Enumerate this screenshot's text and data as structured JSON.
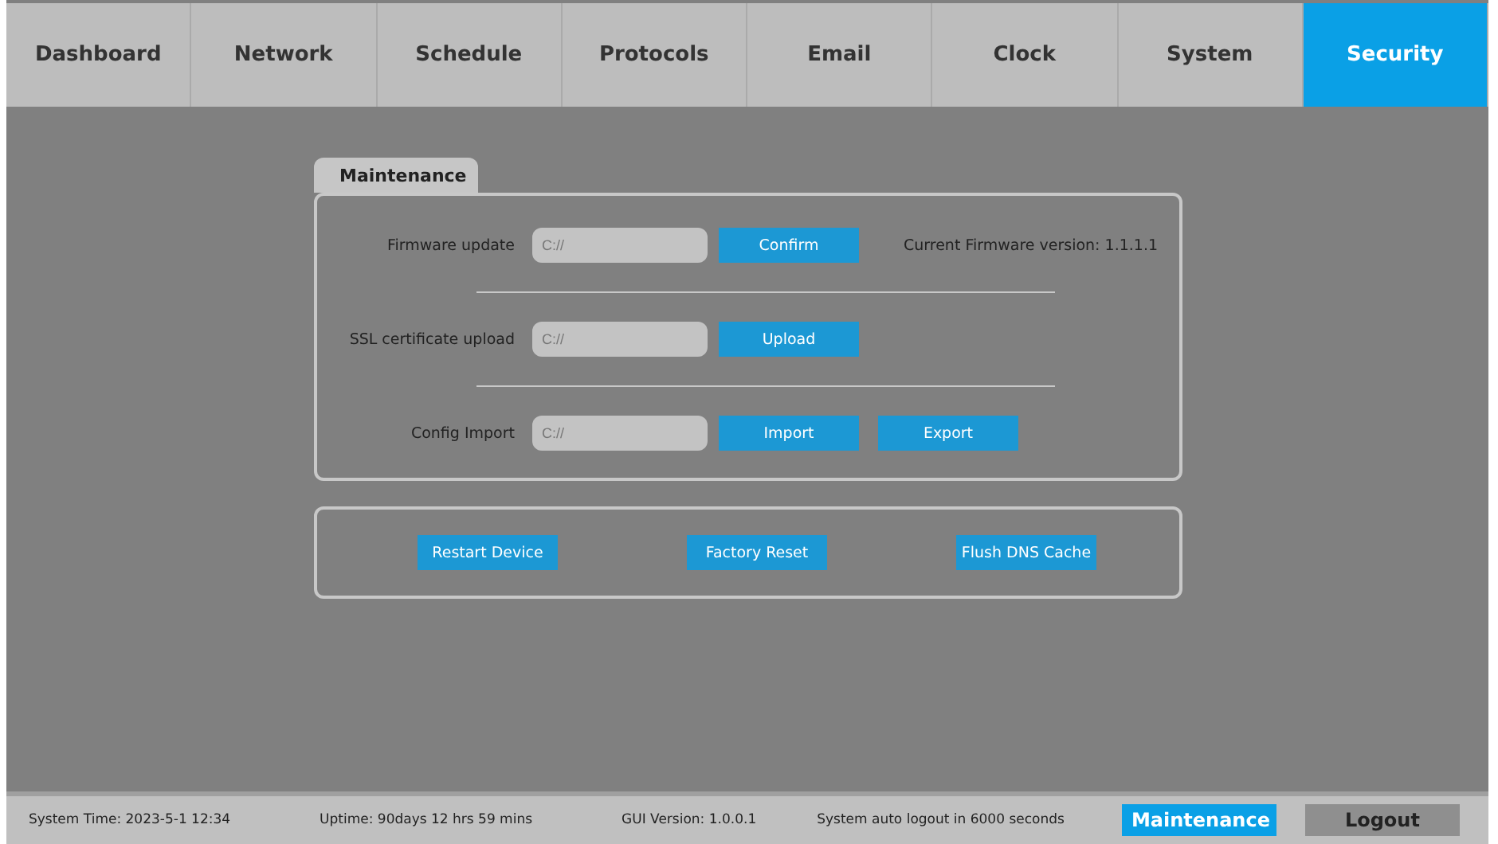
{
  "tabs": [
    {
      "label": "Dashboard",
      "selected": false
    },
    {
      "label": "Network",
      "selected": false
    },
    {
      "label": "Schedule",
      "selected": false
    },
    {
      "label": "Protocols",
      "selected": false
    },
    {
      "label": "Email",
      "selected": false
    },
    {
      "label": "Clock",
      "selected": false
    },
    {
      "label": "System",
      "selected": false
    },
    {
      "label": "Security",
      "selected": true
    }
  ],
  "maintenance": {
    "title": "Maintenance",
    "rows": [
      {
        "label": "Firmware update",
        "placeholder": "C://",
        "buttons": [
          "Confirm"
        ],
        "info": "Current Firmware version: 1.1.1.1"
      },
      {
        "label": "SSL certificate upload",
        "placeholder": "C://",
        "buttons": [
          "Upload"
        ]
      },
      {
        "label": "Config Import",
        "placeholder": "C://",
        "buttons": [
          "Import",
          "Export"
        ]
      }
    ]
  },
  "actions": [
    "Restart Device",
    "Factory Reset",
    "Flush DNS Cache"
  ],
  "status_bar": {
    "texts": [
      "System Time: 2023-5-1 12:34",
      "Uptime: 90days 12 hrs 59 mins",
      "GUI Version: 1.0.0.1",
      "System auto logout in 6000 seconds"
    ],
    "buttons": [
      {
        "label": "Maintenance",
        "selected": true
      },
      {
        "label": "Logout",
        "selected": false
      }
    ]
  }
}
